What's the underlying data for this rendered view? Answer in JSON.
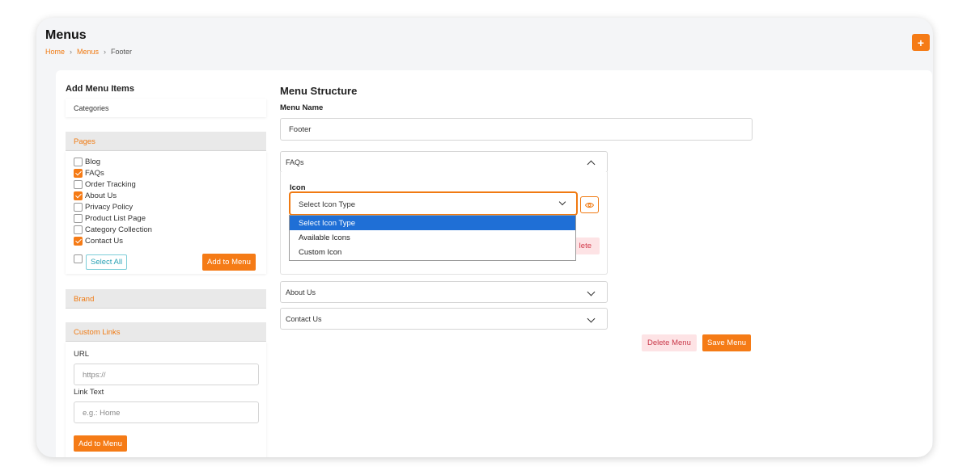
{
  "header": {
    "title": "Menus",
    "breadcrumb": [
      "Home",
      "Menus",
      "Footer"
    ],
    "add_button": "+"
  },
  "left": {
    "title": "Add Menu Items",
    "categories": "Categories",
    "pages": {
      "heading": "Pages",
      "items": [
        {
          "label": "Blog",
          "checked": false
        },
        {
          "label": "FAQs",
          "checked": true
        },
        {
          "label": "Order Tracking",
          "checked": false
        },
        {
          "label": "About Us",
          "checked": true
        },
        {
          "label": "Privacy Policy",
          "checked": false
        },
        {
          "label": "Product List Page",
          "checked": false
        },
        {
          "label": "Category Collection",
          "checked": false
        },
        {
          "label": "Contact Us",
          "checked": true
        }
      ],
      "select_all": "Select All",
      "add_to_menu": "Add to Menu"
    },
    "brand": "Brand",
    "custom_links": {
      "heading": "Custom Links",
      "url_label": "URL",
      "url_placeholder": "https://",
      "link_text_label": "Link Text",
      "link_text_placeholder": "e.g.: Home",
      "add_to_menu": "Add to Menu"
    }
  },
  "right": {
    "title": "Menu Structure",
    "menu_name_label": "Menu Name",
    "menu_name_value": "Footer",
    "items": [
      "FAQs",
      "About Us",
      "Contact Us"
    ],
    "icon_label": "Icon",
    "icon_select_value": "Select Icon Type",
    "icon_options": [
      "Select Icon Type",
      "Available Icons",
      "Custom Icon"
    ],
    "delete_partial": "lete",
    "delete_menu": "Delete Menu",
    "save_menu": "Save Menu"
  },
  "colors": {
    "accent": "#f57b16",
    "select_highlight": "#1f6fd6",
    "danger_bg": "#fde3e5",
    "info": "#2aa2b5"
  }
}
